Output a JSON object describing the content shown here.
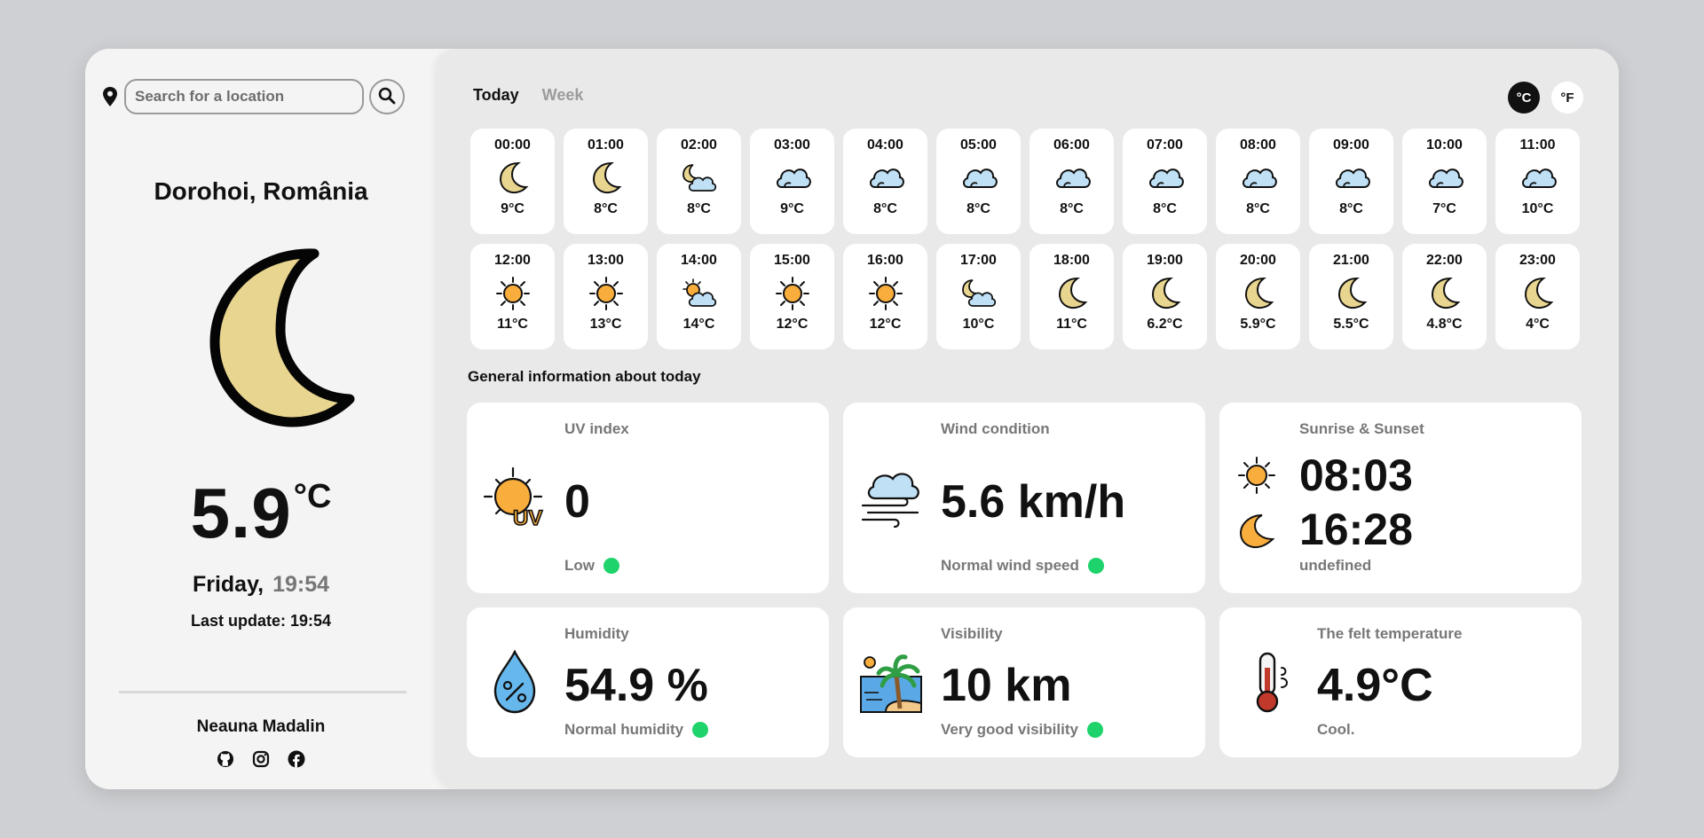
{
  "search": {
    "placeholder": "Search for a location"
  },
  "location": "Dorohoi, România",
  "current": {
    "temp": "5.9",
    "unit": "°C",
    "day": "Friday,",
    "time": "19:54",
    "last_update": "Last update: 19:54",
    "icon": "moon-icon"
  },
  "footer": {
    "author": "Neauna Madalin",
    "socials": [
      "github-icon",
      "instagram-icon",
      "facebook-icon"
    ]
  },
  "tabs": [
    {
      "label": "Today",
      "active": true
    },
    {
      "label": "Week",
      "active": false
    }
  ],
  "units": {
    "celsius": "°C",
    "fahrenheit": "°F",
    "active": "celsius"
  },
  "hourly": [
    {
      "time": "00:00",
      "icon": "moon",
      "temp": "9°C"
    },
    {
      "time": "01:00",
      "icon": "moon",
      "temp": "8°C"
    },
    {
      "time": "02:00",
      "icon": "moon-cloud",
      "temp": "8°C"
    },
    {
      "time": "03:00",
      "icon": "cloud",
      "temp": "9°C"
    },
    {
      "time": "04:00",
      "icon": "cloud",
      "temp": "8°C"
    },
    {
      "time": "05:00",
      "icon": "cloud",
      "temp": "8°C"
    },
    {
      "time": "06:00",
      "icon": "cloud",
      "temp": "8°C"
    },
    {
      "time": "07:00",
      "icon": "cloud",
      "temp": "8°C"
    },
    {
      "time": "08:00",
      "icon": "cloud",
      "temp": "8°C"
    },
    {
      "time": "09:00",
      "icon": "cloud",
      "temp": "8°C"
    },
    {
      "time": "10:00",
      "icon": "cloud",
      "temp": "7°C"
    },
    {
      "time": "11:00",
      "icon": "cloud",
      "temp": "10°C"
    },
    {
      "time": "12:00",
      "icon": "sun",
      "temp": "11°C"
    },
    {
      "time": "13:00",
      "icon": "sun",
      "temp": "13°C"
    },
    {
      "time": "14:00",
      "icon": "sun-cloud",
      "temp": "14°C"
    },
    {
      "time": "15:00",
      "icon": "sun",
      "temp": "12°C"
    },
    {
      "time": "16:00",
      "icon": "sun",
      "temp": "12°C"
    },
    {
      "time": "17:00",
      "icon": "moon-cloud",
      "temp": "10°C"
    },
    {
      "time": "18:00",
      "icon": "moon",
      "temp": "11°C"
    },
    {
      "time": "19:00",
      "icon": "moon",
      "temp": "6.2°C"
    },
    {
      "time": "20:00",
      "icon": "moon",
      "temp": "5.9°C"
    },
    {
      "time": "21:00",
      "icon": "moon",
      "temp": "5.5°C"
    },
    {
      "time": "22:00",
      "icon": "moon",
      "temp": "4.8°C"
    },
    {
      "time": "23:00",
      "icon": "moon",
      "temp": "4°C"
    }
  ],
  "general_title": "General information about today",
  "info": {
    "uv": {
      "title": "UV index",
      "value": "0",
      "status": "Low",
      "icon": "uv-sun-icon"
    },
    "wind": {
      "title": "Wind condition",
      "value": "5.6 km/h",
      "status": "Normal wind speed",
      "icon": "wind-cloud-icon"
    },
    "sun": {
      "title": "Sunrise & Sunset",
      "sunrise": "08:03",
      "sunset": "16:28",
      "status": "undefined"
    },
    "humidity": {
      "title": "Humidity",
      "value": "54.9 %",
      "status": "Normal humidity",
      "icon": "humidity-drop-icon"
    },
    "visibility": {
      "title": "Visibility",
      "value": "10 km",
      "status": "Very good visibility",
      "icon": "beach-icon"
    },
    "felt": {
      "title": "The felt temperature",
      "value": "4.9°C",
      "status": "Cool.",
      "icon": "thermometer-icon"
    }
  },
  "colors": {
    "status_good": "#1ed36b",
    "moon": "#e8d58f",
    "sun": "#f8ad3c",
    "cloud": "#bfe0f5"
  }
}
